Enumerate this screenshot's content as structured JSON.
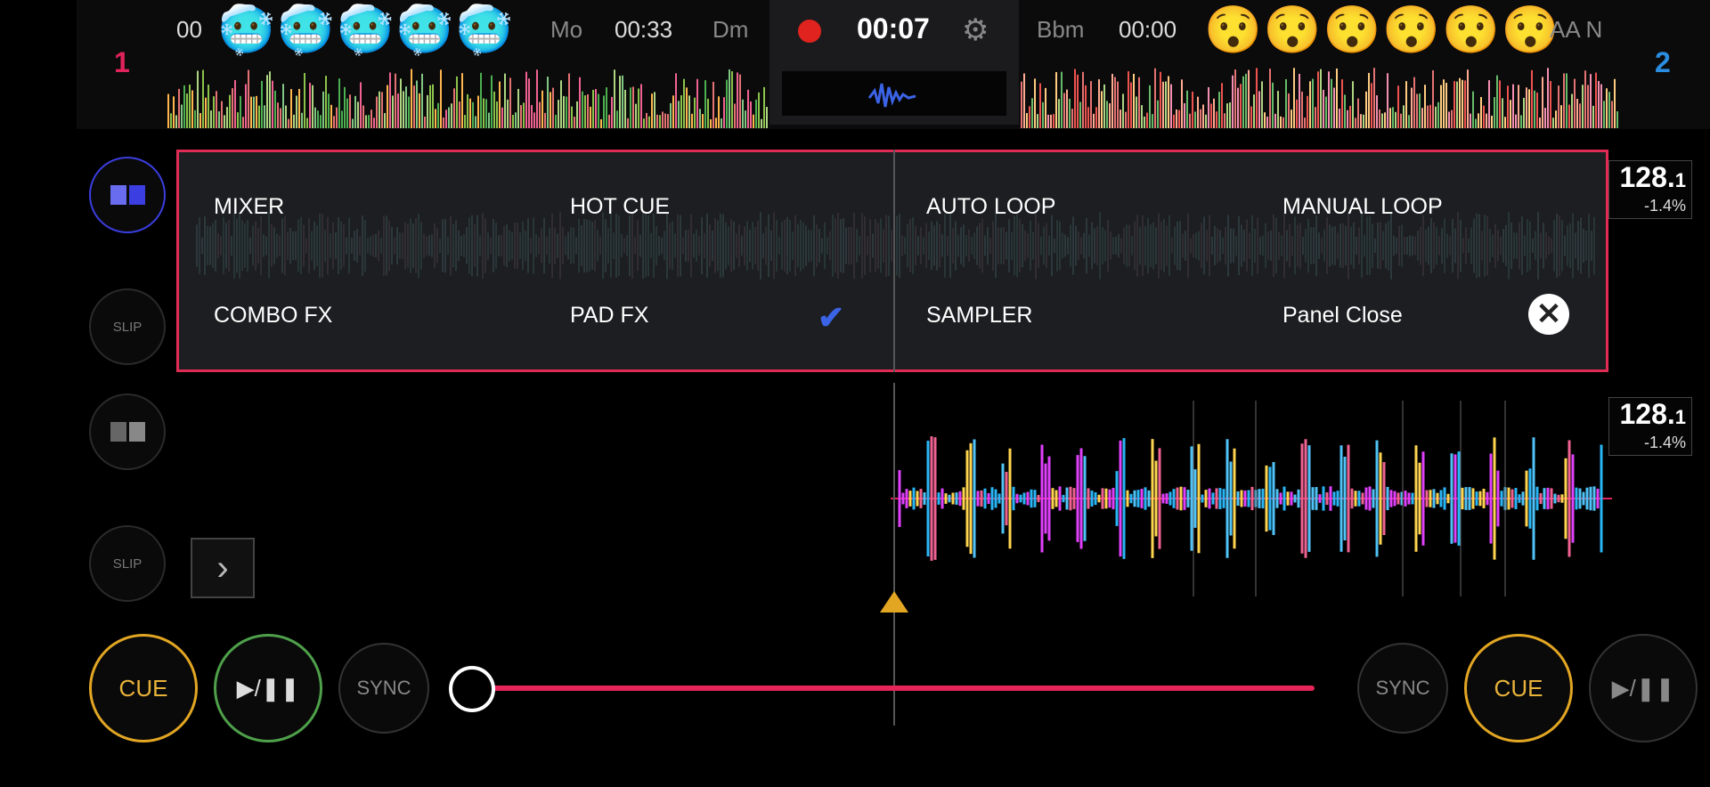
{
  "deck_left": {
    "number": "1",
    "time_elapsed_prefix": "00",
    "title_tail": "Mo",
    "time_remaining": "00:33",
    "key": "Dm",
    "emoji": [
      "🥶",
      "🥶",
      "🥶",
      "🥶",
      "🥶"
    ],
    "bpm": "128.",
    "bpm_decimal": "1",
    "pitch": "-1.4%",
    "slip_label": "SLIP",
    "cue_label": "CUE",
    "play_label": "▶/❚❚",
    "sync_label": "SYNC"
  },
  "deck_right": {
    "number": "2",
    "key": "Bbm",
    "time_elapsed": "00:00",
    "title_tail": "AA N",
    "emoji": [
      "😯",
      "😯",
      "😯",
      "😯",
      "😯",
      "😯"
    ],
    "bpm": "128.",
    "bpm_decimal": "1",
    "pitch": "-1.4%",
    "slip_label": "SLIP",
    "cue_label": "CUE",
    "play_label": "▶/❚❚",
    "sync_label": "SYNC"
  },
  "recorder": {
    "time": "00:07",
    "record_icon": "record-icon",
    "settings_icon": "gear-icon"
  },
  "panel_menu": {
    "items": [
      {
        "label": "MIXER"
      },
      {
        "label": "HOT CUE"
      },
      {
        "label": "AUTO LOOP"
      },
      {
        "label": "MANUAL LOOP"
      },
      {
        "label": "COMBO FX"
      },
      {
        "label": "PAD FX",
        "checked": true
      },
      {
        "label": "SAMPLER"
      },
      {
        "label": "Panel Close"
      }
    ]
  },
  "crossfader": {
    "position": 0.0
  },
  "colors": {
    "accent_red": "#e02c55",
    "cue_orange": "#e2a623",
    "play_green": "#4ea04a",
    "deck1_red": "#e0235b",
    "deck2_blue": "#2a8de0",
    "check_blue": "#3b63e6"
  },
  "icons": {
    "panel_toggle": "layout-icon",
    "chevron": "chevron-right-icon",
    "close": "close-circle-icon",
    "check": "checkmark-icon"
  }
}
